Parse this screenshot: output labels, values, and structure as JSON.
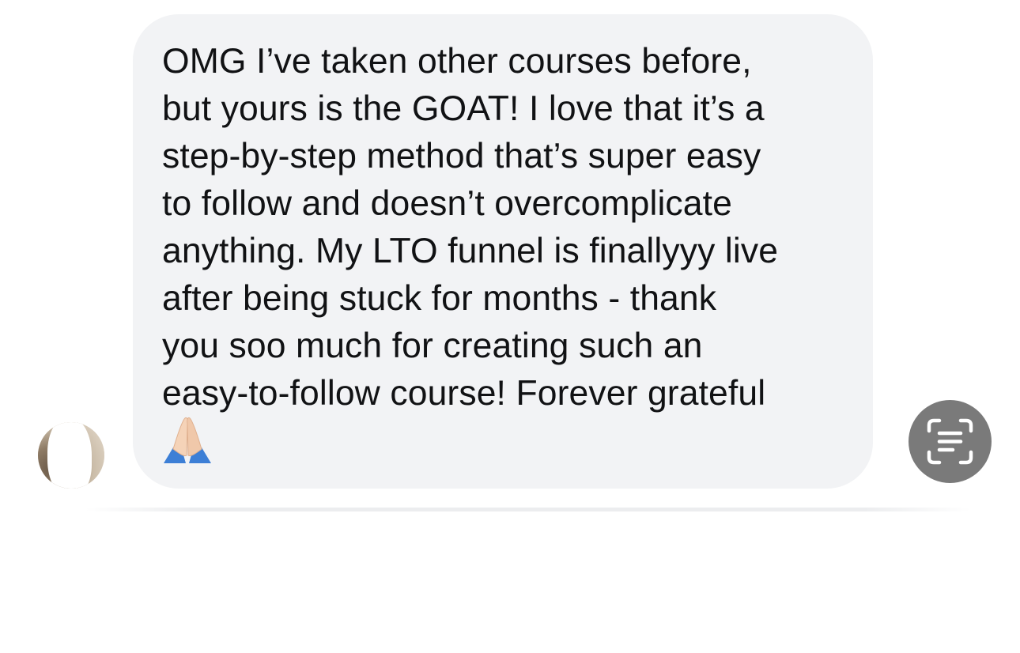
{
  "message": {
    "text": "OMG I’ve taken other courses before,\nbut yours is the GOAT! I love that it’s a\nstep-by-step method that’s super easy\nto follow and doesn’t overcomplicate\nanything. My LTO funnel is finallyyy live\nafter being stuck for months - thank\nyou soo much for creating such an\neasy-to-follow course! Forever grateful",
    "emoji": "folded-hands-emoji",
    "bubble_color": "#f2f3f5",
    "text_color": "#111214"
  },
  "sender": {
    "avatar": "profile-photo"
  },
  "actions": {
    "scan_text_icon": "live-text-scan-icon",
    "scan_button_color": "#7a7a7a"
  }
}
